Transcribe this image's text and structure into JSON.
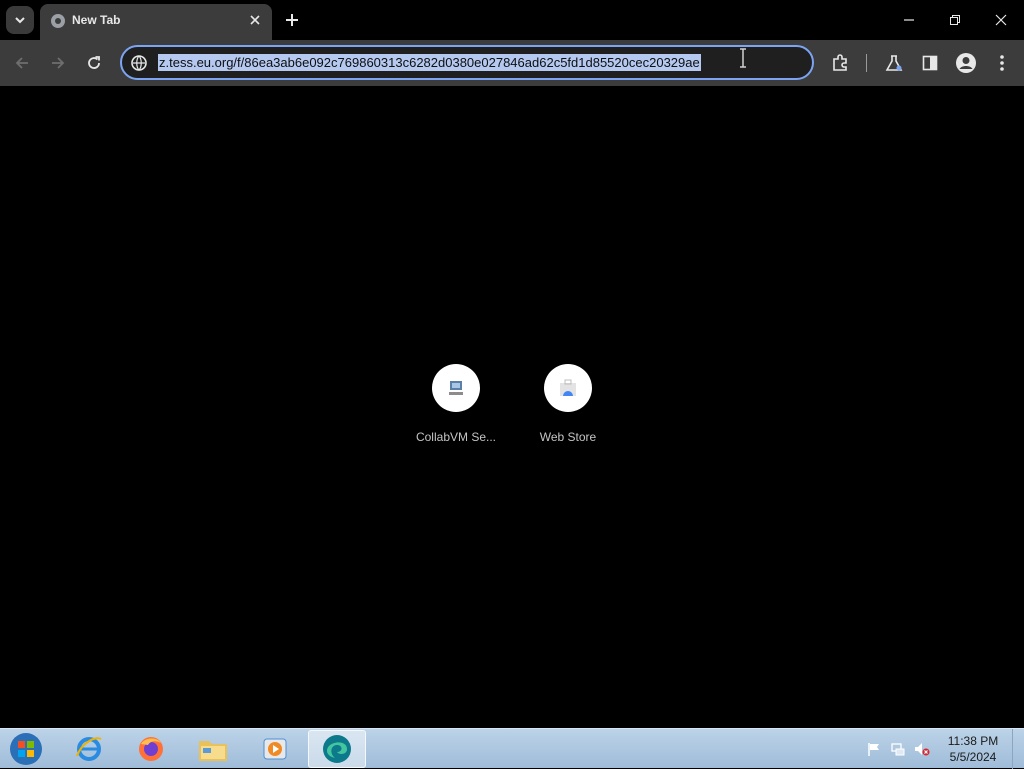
{
  "browser": {
    "tab": {
      "title": "New Tab"
    },
    "address_bar": {
      "url": "z.tess.eu.org/f/86ea3ab6e092c769860313c6282d0380e027846ad62c5fd1d85520cec20329ae"
    }
  },
  "new_tab_page": {
    "shortcuts": [
      {
        "label": "CollabVM Se...",
        "icon": "collabvm-icon"
      },
      {
        "label": "Web Store",
        "icon": "web-store-icon"
      }
    ]
  },
  "taskbar": {
    "apps": [
      {
        "name": "internet-explorer",
        "icon": "ie-icon"
      },
      {
        "name": "firefox",
        "icon": "firefox-icon"
      },
      {
        "name": "file-explorer",
        "icon": "folder-icon"
      },
      {
        "name": "media-player",
        "icon": "media-player-icon"
      },
      {
        "name": "edge-browser",
        "icon": "edge-icon",
        "active": true
      }
    ],
    "clock": {
      "time": "11:38 PM",
      "date": "5/5/2024"
    }
  },
  "colors": {
    "toolbar": "#3c3c3c",
    "omnibox_border": "#7ca4f3",
    "url_selection": "#b4c8f0",
    "taskbar": "#bcd3e8"
  }
}
